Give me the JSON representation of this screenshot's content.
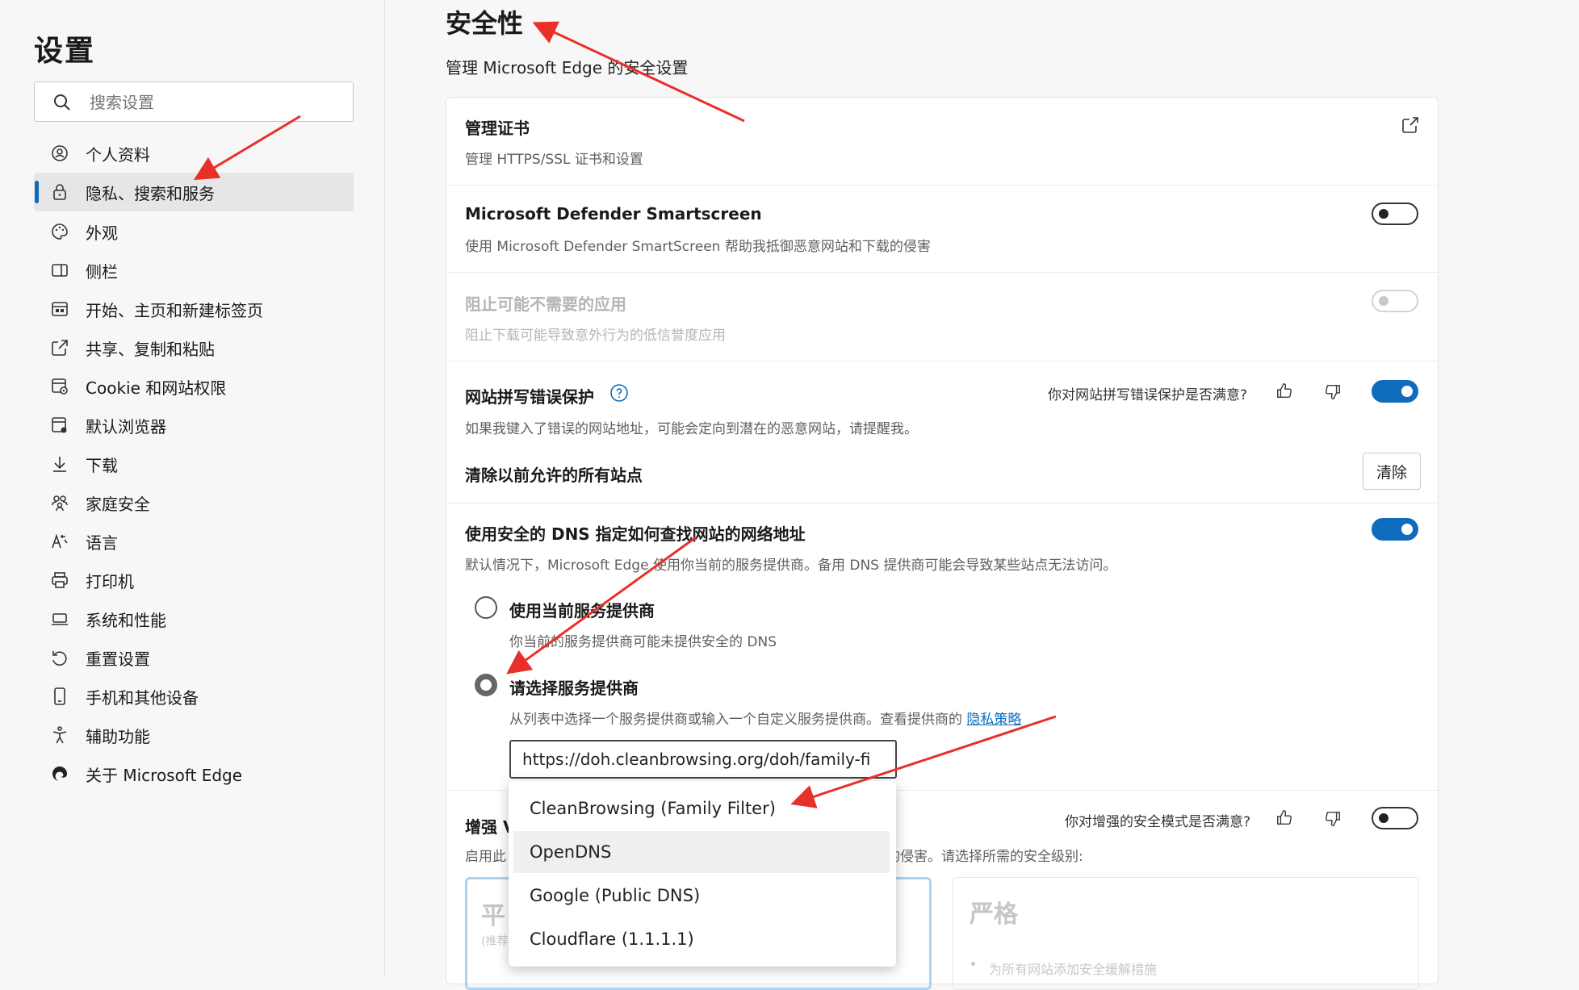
{
  "sidebar": {
    "title": "设置",
    "search_placeholder": "搜索设置",
    "items": [
      {
        "label": "个人资料",
        "icon": "profile-icon"
      },
      {
        "label": "隐私、搜索和服务",
        "icon": "lock-icon",
        "active": true
      },
      {
        "label": "外观",
        "icon": "palette-icon"
      },
      {
        "label": "侧栏",
        "icon": "sidebar-icon"
      },
      {
        "label": "开始、主页和新建标签页",
        "icon": "home-tab-icon"
      },
      {
        "label": "共享、复制和粘贴",
        "icon": "share-icon"
      },
      {
        "label": "Cookie 和网站权限",
        "icon": "cookie-permissions-icon"
      },
      {
        "label": "默认浏览器",
        "icon": "browser-icon"
      },
      {
        "label": "下载",
        "icon": "download-icon"
      },
      {
        "label": "家庭安全",
        "icon": "family-icon"
      },
      {
        "label": "语言",
        "icon": "language-icon"
      },
      {
        "label": "打印机",
        "icon": "printer-icon"
      },
      {
        "label": "系统和性能",
        "icon": "laptop-icon"
      },
      {
        "label": "重置设置",
        "icon": "reset-icon"
      },
      {
        "label": "手机和其他设备",
        "icon": "phone-icon"
      },
      {
        "label": "辅助功能",
        "icon": "accessibility-icon"
      },
      {
        "label": "关于 Microsoft Edge",
        "icon": "edge-logo-icon"
      }
    ]
  },
  "main": {
    "title": "安全性",
    "subtitle": "管理 Microsoft Edge 的安全设置",
    "certs": {
      "title": "管理证书",
      "desc": "管理 HTTPS/SSL 证书和设置"
    },
    "smartscreen": {
      "title": "Microsoft Defender Smartscreen",
      "desc": "使用 Microsoft Defender SmartScreen 帮助我抵御恶意网站和下载的侵害",
      "enabled": false
    },
    "pua": {
      "title": "阻止可能不需要的应用",
      "desc": "阻止下载可能导致意外行为的低信誉度应用",
      "enabled": false,
      "disabled": true
    },
    "typo": {
      "title": "网站拼写错误保护",
      "desc": "如果我键入了错误的网站地址，可能会定向到潜在的恶意网站，请提醒我。",
      "feedback": "你对网站拼写错误保护是否满意?",
      "enabled": true
    },
    "clear_sites": {
      "title": "清除以前允许的所有站点",
      "button": "清除"
    },
    "dns": {
      "title": "使用安全的 DNS 指定如何查找网站的网络地址",
      "desc": "默认情况下，Microsoft Edge 使用你当前的服务提供商。备用 DNS 提供商可能会导致某些站点无法访问。",
      "enabled": true,
      "option_current": {
        "label": "使用当前服务提供商",
        "desc": "你当前的服务提供商可能未提供安全的 DNS"
      },
      "option_choose": {
        "label": "请选择服务提供商",
        "desc": "从列表中选择一个服务提供商或输入一个自定义服务提供商。查看提供商的",
        "link": "隐私策略"
      },
      "input_value": "https://doh.cleanbrowsing.org/doh/family-fi",
      "dropdown": [
        "CleanBrowsing (Family Filter)",
        "OpenDNS",
        "Google (Public DNS)",
        "Cloudflare (1.1.1.1)"
      ],
      "hovered_option": "OpenDNS"
    },
    "enhanced": {
      "title_visible": "增强 V",
      "desc_left": "启用此",
      "desc_right": "的侵害。请选择所需的安全级别:",
      "feedback": "你对增强的安全模式是否满意?",
      "enabled": false,
      "balanced_title": "平",
      "balanced_note": "(推荐",
      "strict_title": "严格",
      "strict_desc": "为所有网站添加安全缓解措施"
    }
  },
  "colors": {
    "accent": "#0f6cbd",
    "annotation_arrow": "#e8302a"
  }
}
